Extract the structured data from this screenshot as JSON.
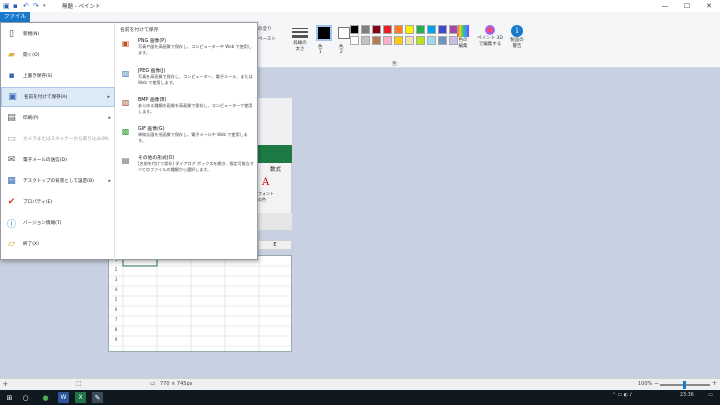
{
  "titlebar": {
    "title": "無題 - ペイント"
  },
  "ribbon": {
    "file_tab": "ファイル",
    "outline_label": "枠線の\n太さ",
    "color1_label": "色\n1",
    "color2_label": "色\n2",
    "edit_colors_label": "色の\n編集",
    "paint3d_label": "ペイント 3D\nで編集する",
    "product_alert_label": "製品の\n警告",
    "colors_group_label": "色",
    "partial_label_1": "の塗り",
    "partial_label_2": "ペースト"
  },
  "palette": [
    "#000000",
    "#7f7f7f",
    "#880015",
    "#ed1c24",
    "#ff7f27",
    "#fff200",
    "#22b14c",
    "#00a2e8",
    "#3f48cc",
    "#a349a4",
    "#ffffff",
    "#c3c3c3",
    "#b97a57",
    "#ffaec9",
    "#ffc90e",
    "#efe4b0",
    "#b5e61d",
    "#99d9ea",
    "#7092be",
    "#c8bfe7"
  ],
  "file_menu": {
    "items": [
      {
        "label": "新規(N)",
        "icon": "new-file-icon"
      },
      {
        "label": "開く(O)",
        "icon": "open-folder-icon"
      },
      {
        "label": "上書き保存(S)",
        "icon": "save-icon"
      },
      {
        "label": "名前を付けて保存(A)",
        "icon": "save-as-icon",
        "selected": true,
        "submenu": true
      },
      {
        "label": "印刷(P)",
        "icon": "printer-icon",
        "submenu": true
      },
      {
        "label": "カメラまたはスキャナーから取り込み(M)",
        "icon": "scanner-icon",
        "disabled": true
      },
      {
        "label": "電子メールの送信(D)",
        "icon": "email-icon"
      },
      {
        "label": "デスクトップの背景として設定(B)",
        "icon": "desktop-background-icon",
        "submenu": true
      },
      {
        "label": "プロパティ(E)",
        "icon": "checkmark-icon"
      },
      {
        "label": "バージョン情報(T)",
        "icon": "info-icon"
      },
      {
        "label": "終了(X)",
        "icon": "exit-icon"
      }
    ],
    "submenu_heading": "名前を付けて保存",
    "save_as": [
      {
        "title": "PNG 画像(P)",
        "desc": "写真や図を高画質で保存し、コンピューターや Web で使用します。",
        "icon": "png-image-icon"
      },
      {
        "title": "JPEG 画像(J)",
        "desc": "写真を高画質で保存し、コンピューター、電子メール、または Web で使用します。",
        "icon": "jpeg-image-icon"
      },
      {
        "title": "BMP 画像(B)",
        "desc": "あらゆる種類の画像を高画質で保存し、コンピューターで使用します。",
        "icon": "bmp-image-icon"
      },
      {
        "title": "GIF 画像(G)",
        "desc": "単純な図を低画質で保存し、電子メールや Web で使用します。",
        "icon": "gif-image-icon"
      },
      {
        "title": "その他の形式(O)",
        "desc": "[名前を付けて保存] ダイアログ ボックスを開き、指定可能なすべてのファイルの種類から選択します。",
        "icon": "other-formats-icon"
      }
    ]
  },
  "canvas_content": {
    "column_header": "E",
    "toolbar_label": "数式",
    "font_label": "フォント\nの色",
    "row_numbers": [
      "1",
      "2",
      "3",
      "4",
      "5",
      "6",
      "7",
      "8",
      "9"
    ]
  },
  "statusbar": {
    "dimensions": "770 × 745px",
    "zoom": "100%"
  },
  "taskbar": {
    "time": "23:36"
  }
}
